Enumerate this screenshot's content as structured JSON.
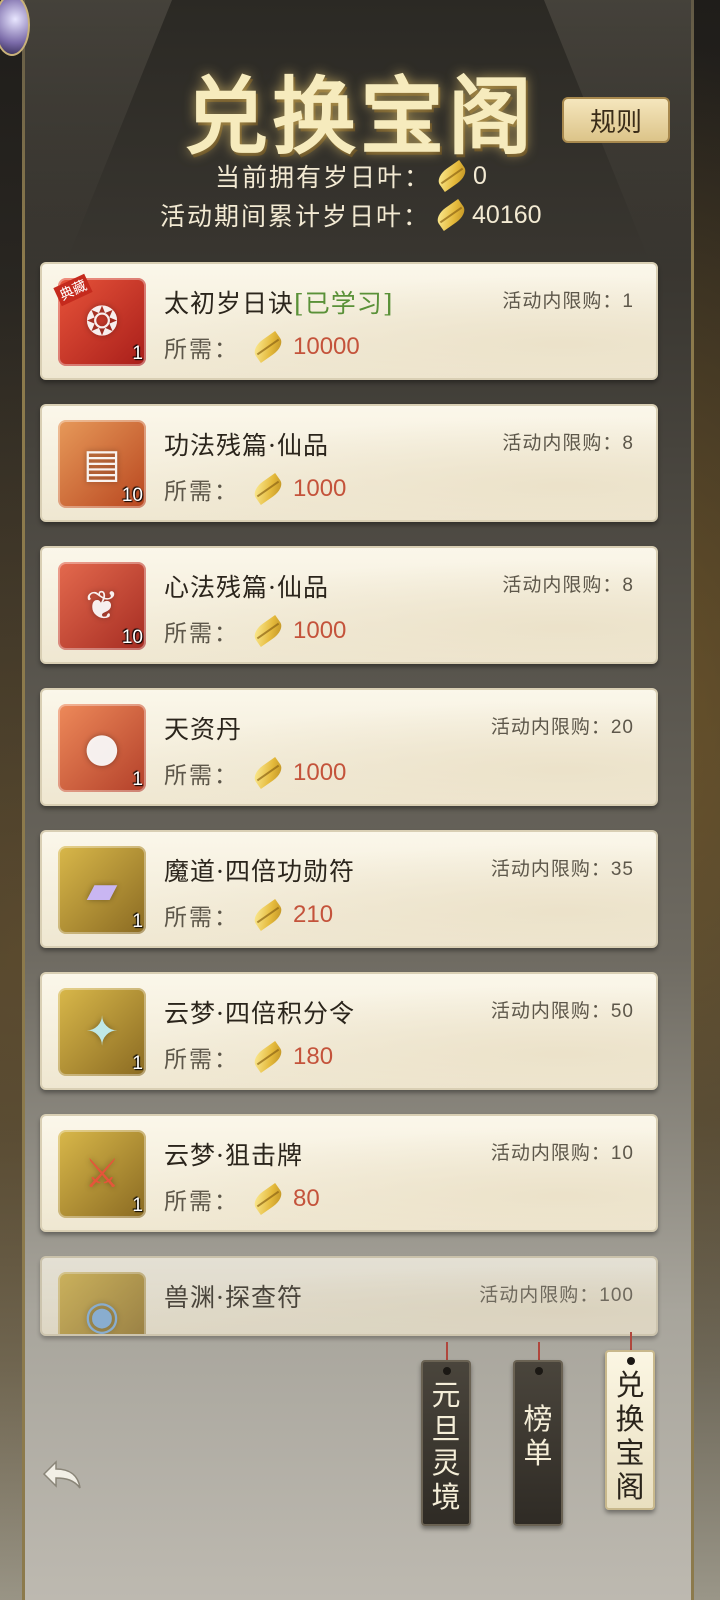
{
  "header": {
    "title": "兑换宝阁",
    "rules_label": "规则",
    "owned_label": "当前拥有岁日叶：",
    "owned_value": "0",
    "total_label": "活动期间累计岁日叶：",
    "total_value": "40160"
  },
  "cost_label": "所需：",
  "limit_label": "活动内限购：",
  "items": [
    {
      "name": "太初岁日诀",
      "learned": "[已学习]",
      "limit": "1",
      "cost": "10000",
      "count": "1",
      "badge": "典藏"
    },
    {
      "name": "功法残篇·仙品",
      "learned": "",
      "limit": "8",
      "cost": "1000",
      "count": "10",
      "badge": ""
    },
    {
      "name": "心法残篇·仙品",
      "learned": "",
      "limit": "8",
      "cost": "1000",
      "count": "10",
      "badge": ""
    },
    {
      "name": "天资丹",
      "learned": "",
      "limit": "20",
      "cost": "1000",
      "count": "1",
      "badge": ""
    },
    {
      "name": "魔道·四倍功勋符",
      "learned": "",
      "limit": "35",
      "cost": "210",
      "count": "1",
      "badge": ""
    },
    {
      "name": "云梦·四倍积分令",
      "learned": "",
      "limit": "50",
      "cost": "180",
      "count": "1",
      "badge": ""
    },
    {
      "name": "云梦·狙击牌",
      "learned": "",
      "limit": "10",
      "cost": "80",
      "count": "1",
      "badge": ""
    },
    {
      "name": "兽渊·探查符",
      "learned": "",
      "limit": "100",
      "cost": "",
      "count": "",
      "badge": ""
    }
  ],
  "tabs": [
    {
      "label": "元\n旦\n灵\n境"
    },
    {
      "label": "榜\n单"
    },
    {
      "label": "兑\n换\n宝\n阁"
    }
  ],
  "icons": {
    "leaf": "golden-leaf-icon",
    "back": "back-arrow-icon"
  },
  "colors": {
    "price": "#c4533b",
    "learned": "#5a9138",
    "title": "#f6ebbd"
  }
}
